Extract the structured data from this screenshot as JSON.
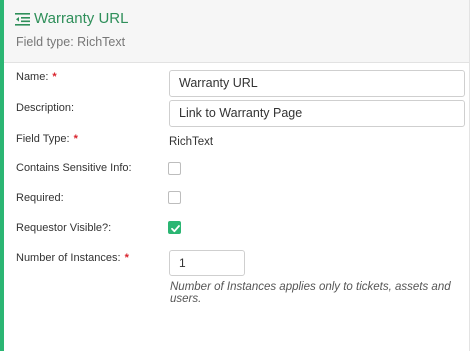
{
  "header": {
    "title": "Warranty URL",
    "subtitle": "Field type: RichText"
  },
  "form": {
    "name_label": "Name:",
    "name_value": "Warranty URL",
    "description_label": "Description:",
    "description_value": "Link to Warranty Page",
    "field_type_label": "Field Type:",
    "field_type_value": "RichText",
    "sensitive_label": "Contains Sensitive Info:",
    "sensitive_checked": false,
    "required_label": "Required:",
    "required_checked": false,
    "requestor_visible_label": "Requestor Visible?:",
    "requestor_visible_checked": true,
    "instances_label": "Number of Instances:",
    "instances_value": "1",
    "instances_note": "Number of Instances applies only to tickets, assets and users.",
    "required_marker": "*"
  },
  "colors": {
    "accent": "#2bb673",
    "title": "#2f8f5a",
    "required": "#d9232d"
  }
}
